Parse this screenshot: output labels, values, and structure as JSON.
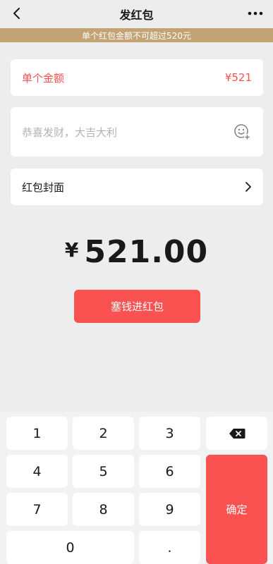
{
  "nav": {
    "title": "发红包",
    "back_icon": "chevron-left-icon",
    "more_icon": "more-horizontal-icon"
  },
  "warning": {
    "text": "单个红包金额不可超过520元",
    "color": "#c3a374"
  },
  "amount_row": {
    "label": "单个金额",
    "value": "¥521",
    "color": "#fa5151"
  },
  "greeting": {
    "placeholder": "恭喜发财，大吉大利",
    "icon": "emoji-icon"
  },
  "cover": {
    "label": "红包封面",
    "icon": "chevron-right-icon"
  },
  "total": {
    "currency": "¥",
    "amount": "521.00"
  },
  "send_button": {
    "label": "塞钱进红包",
    "color": "#fa5151"
  },
  "keypad": {
    "keys": [
      "1",
      "2",
      "3",
      "4",
      "5",
      "6",
      "7",
      "8",
      "9",
      "0",
      "."
    ],
    "backspace_icon": "backspace-icon",
    "confirm_label": "确定"
  }
}
